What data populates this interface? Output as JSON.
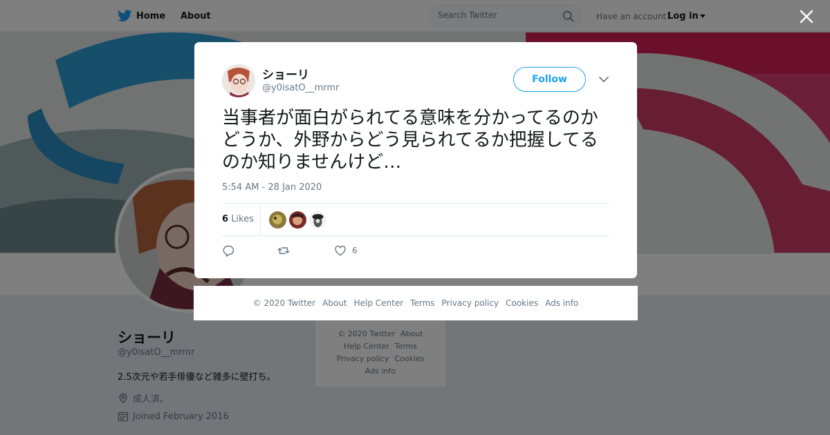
{
  "topnav": {
    "home_label": "Home",
    "about_label": "About",
    "search_placeholder": "Search Twitter",
    "have_account_text": "Have an account?",
    "login_label": "Log in"
  },
  "profile": {
    "name": "ショーリ",
    "handle": "@y0isatO__mrmr",
    "bio": "2.5次元や若手俳優など雑多に壁打ち。",
    "location": "成人済。",
    "joined": "Joined February 2016"
  },
  "side_footer": {
    "copyright": "© 2020 Twitter",
    "about": "About",
    "help_center": "Help Center",
    "terms": "Terms",
    "privacy": "Privacy policy",
    "cookies": "Cookies",
    "ads_info": "Ads info"
  },
  "tweet": {
    "author_name": "ショーリ",
    "author_handle": "@y0isatO__mrmr",
    "follow_label": "Follow",
    "text": "当事者が面白がられてる意味を分かってるのかどうか、外野からどう見られてるか把握してるのか知りませんけど…",
    "timestamp": "5:54 AM - 28 Jan 2020",
    "likes_count": "6",
    "likes_label": "Likes",
    "action_like_count": "6"
  },
  "modal_footer": {
    "copyright": "© 2020 Twitter",
    "about": "About",
    "help_center": "Help Center",
    "terms": "Terms",
    "privacy": "Privacy policy",
    "cookies": "Cookies",
    "ads_info": "Ads info"
  },
  "colors": {
    "brand": "#1da1f2",
    "text_primary": "#14171a",
    "text_secondary": "#657786",
    "overlay": "rgba(0,0,0,0.5)"
  },
  "icons": {
    "logo": "twitter-bird-icon",
    "search": "search-icon",
    "close": "close-icon",
    "more": "chevron-down-icon",
    "reply": "reply-icon",
    "retweet": "retweet-icon",
    "like": "heart-icon",
    "location": "location-pin-icon",
    "calendar": "calendar-icon"
  }
}
